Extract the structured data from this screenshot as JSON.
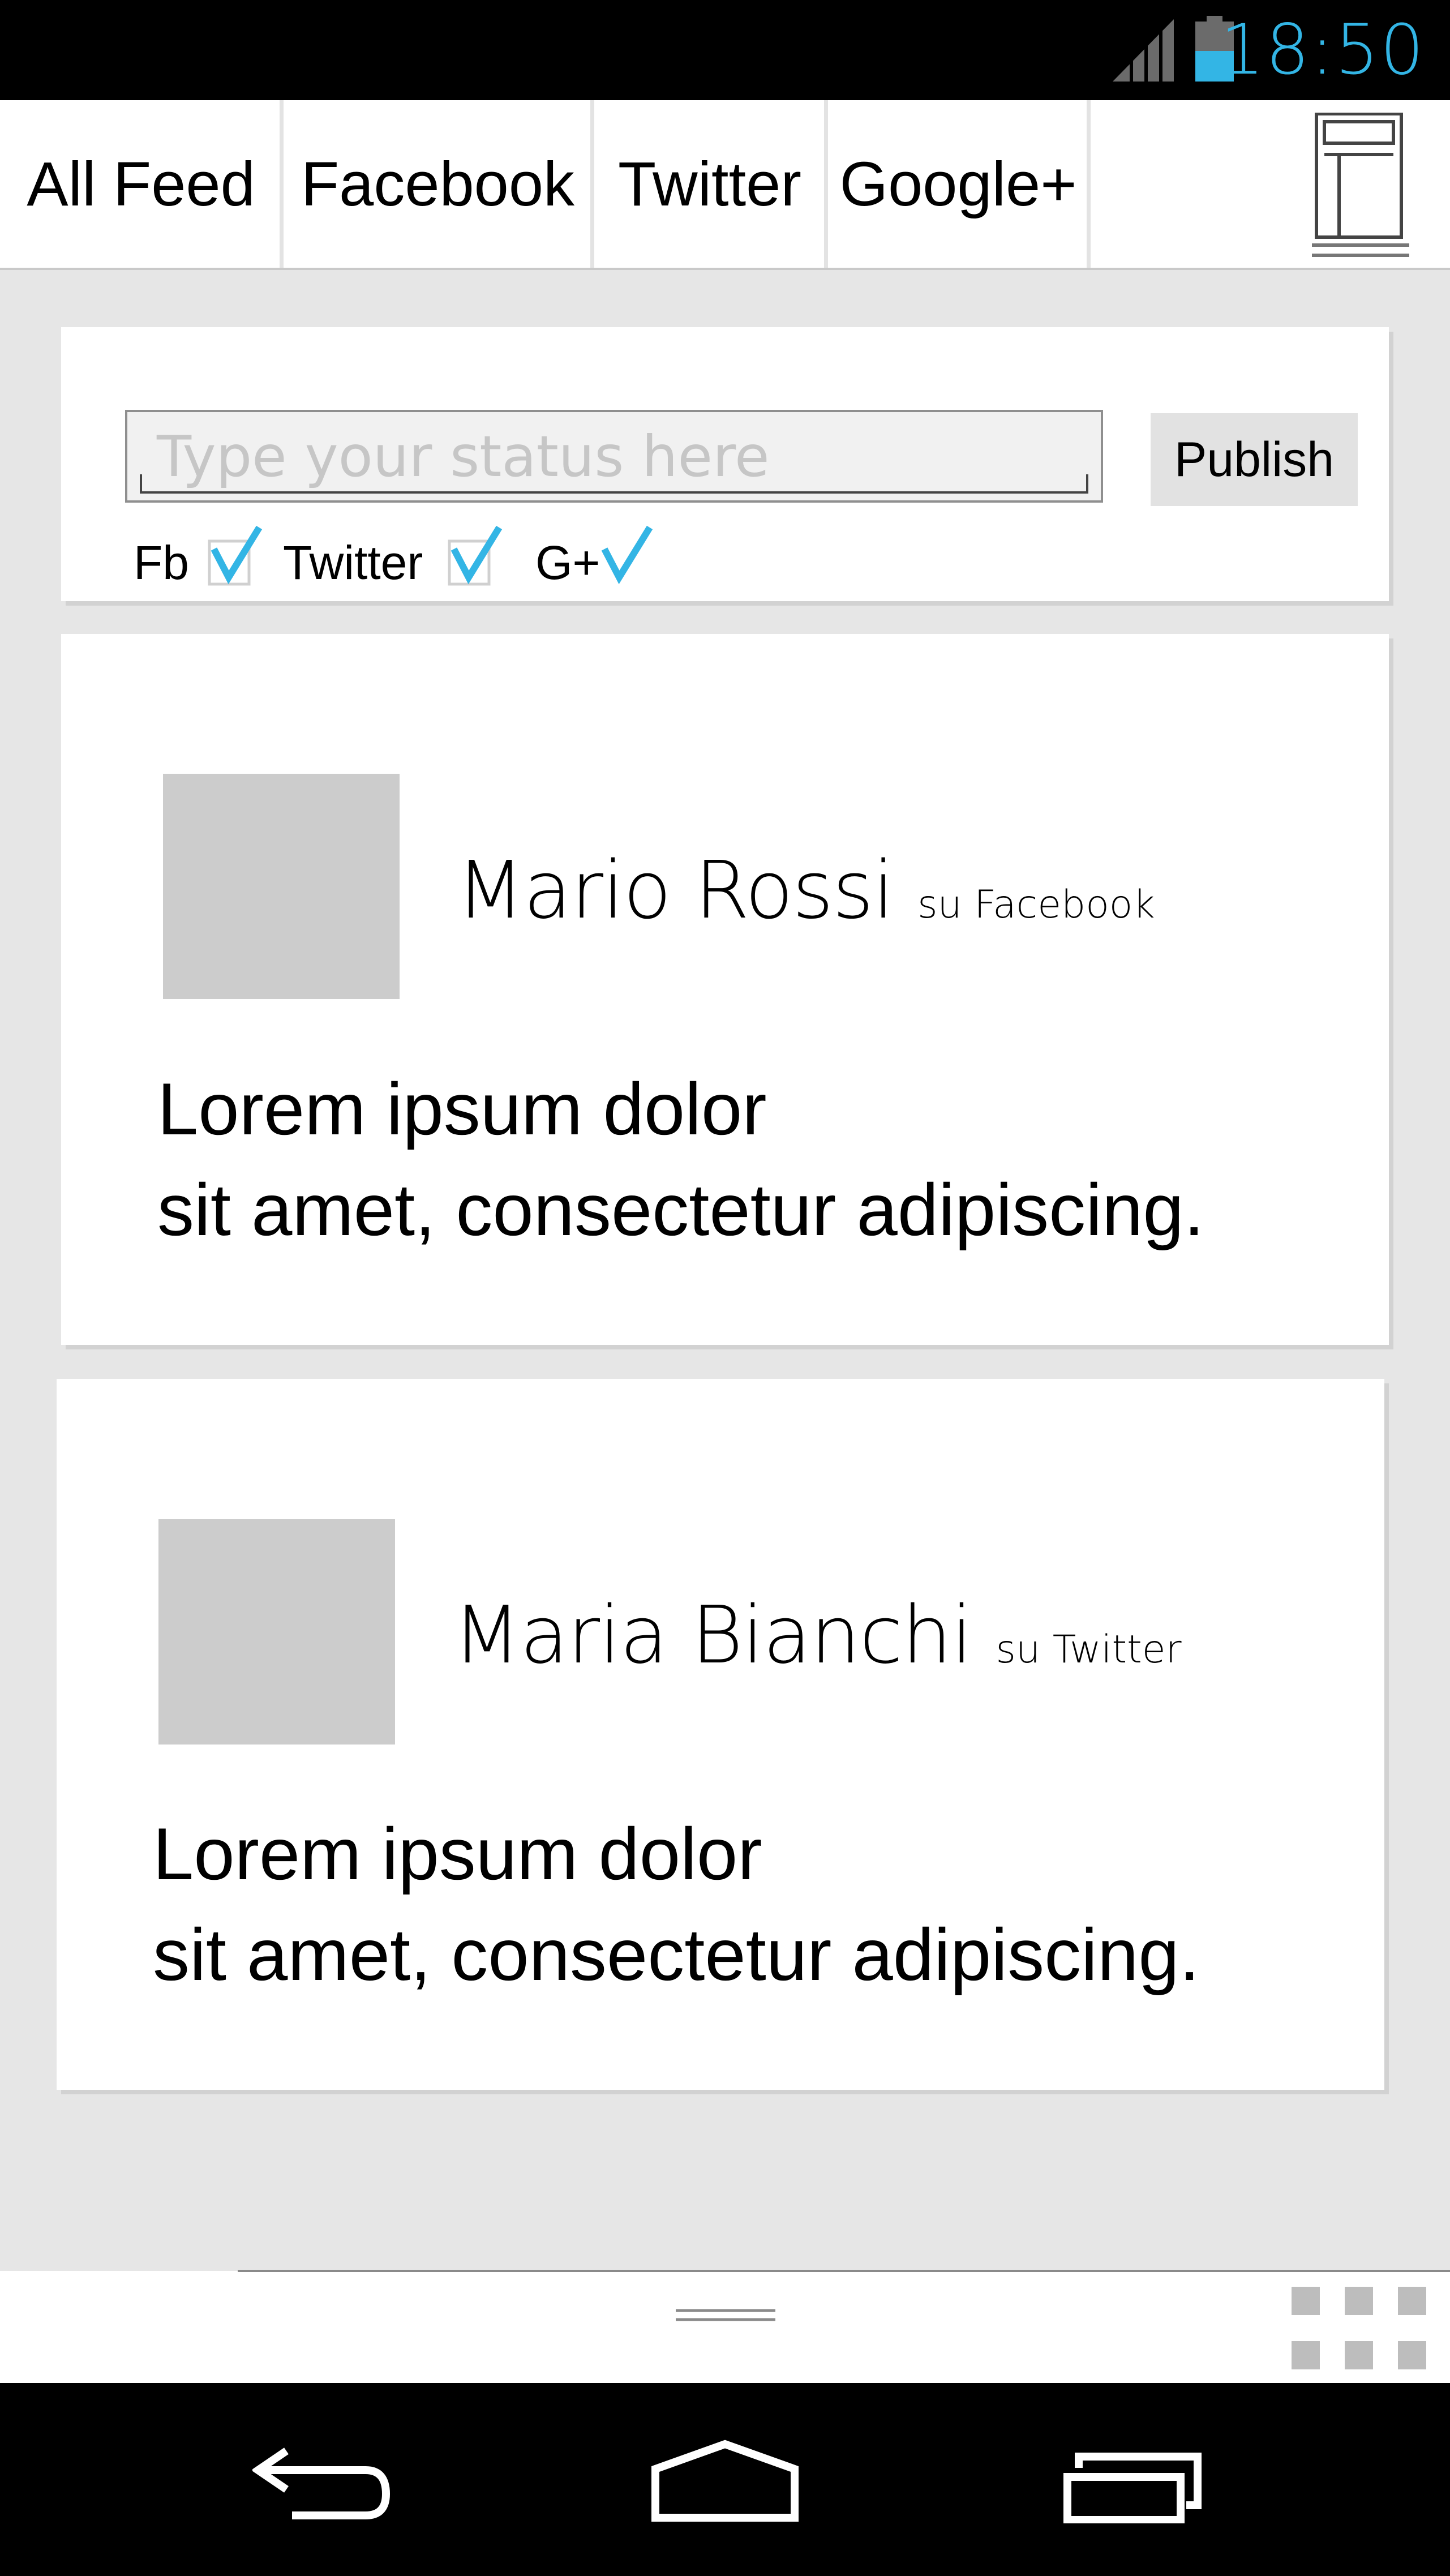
{
  "status_bar": {
    "time": "18:50",
    "icons": [
      "signal-icon",
      "battery-icon"
    ]
  },
  "tabs": [
    {
      "label": "All Feed"
    },
    {
      "label": "Facebook"
    },
    {
      "label": "Twitter"
    },
    {
      "label": "Google+"
    }
  ],
  "composer": {
    "placeholder": "Type your status here",
    "publish_label": "Publish",
    "networks": [
      {
        "label": "Fb",
        "checked": true
      },
      {
        "label": "Twitter",
        "checked": true
      },
      {
        "label": "G+",
        "checked": true
      }
    ]
  },
  "posts": [
    {
      "author": "Mario Rossi",
      "via": "su Facebook",
      "line1": "Lorem ipsum dolor",
      "line2": "sit amet, consectetur adipiscing."
    },
    {
      "author": "Maria Bianchi",
      "via": "su Twitter",
      "line1": "Lorem ipsum dolor",
      "line2": "sit amet, consectetur adipiscing."
    }
  ],
  "colors": {
    "accent": "#33b5e5",
    "placeholder_gray": "#cccccc"
  }
}
